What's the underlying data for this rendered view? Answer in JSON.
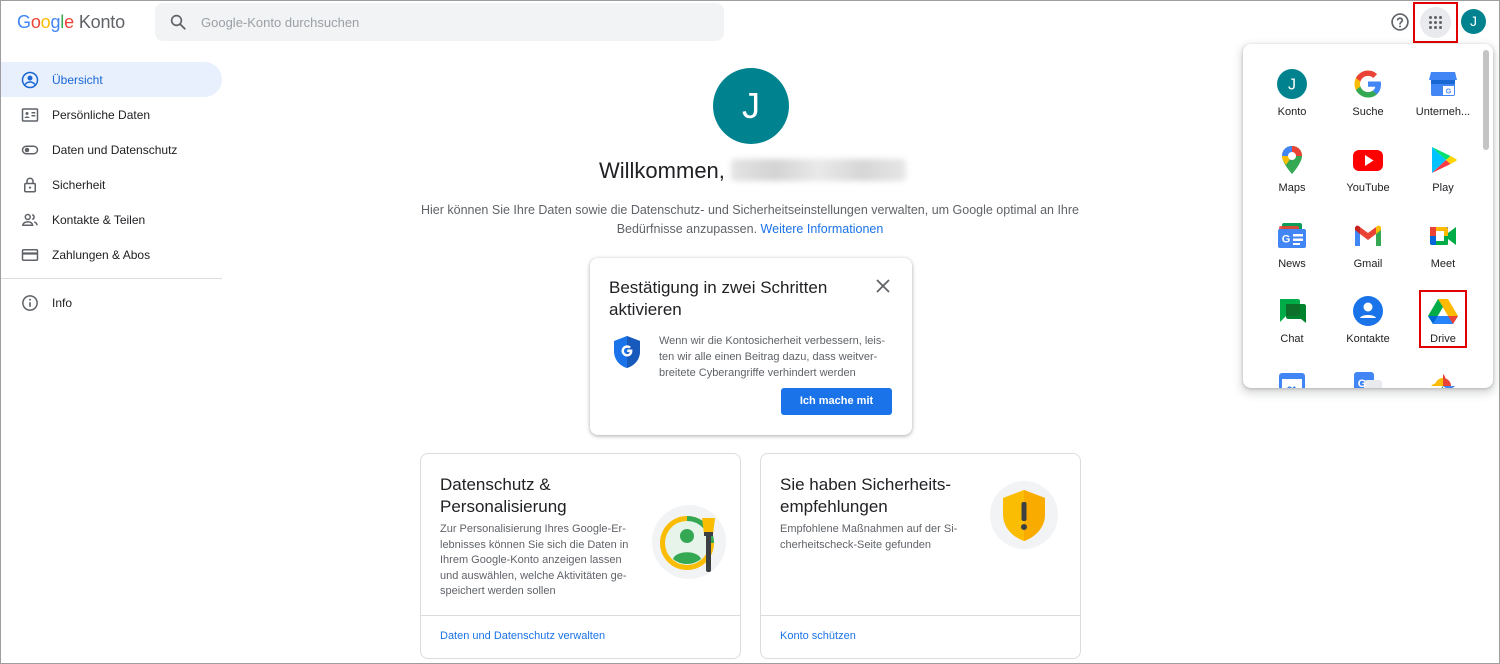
{
  "header": {
    "logo_google": "Google",
    "logo_konto": "Konto",
    "search_placeholder": "Google-Konto durchsuchen",
    "avatar_letter": "J"
  },
  "sidebar": {
    "items": [
      {
        "label": "Übersicht",
        "icon": "account-circle-icon",
        "active": true
      },
      {
        "label": "Persönliche Daten",
        "icon": "id-card-icon"
      },
      {
        "label": "Daten und Datenschutz",
        "icon": "toggle-icon"
      },
      {
        "label": "Sicherheit",
        "icon": "lock-icon"
      },
      {
        "label": "Kontakte & Teilen",
        "icon": "people-icon"
      },
      {
        "label": "Zahlungen & Abos",
        "icon": "credit-card-icon"
      }
    ],
    "info_label": "Info"
  },
  "main": {
    "avatar_letter": "J",
    "welcome": "Willkommen,",
    "intro": "Hier können Sie Ihre Daten sowie die Datenschutz- und Sicherheitseinstellungen verwalten, um Google optimal an Ihre Bedürfnisse anzupassen.",
    "intro_link": "Weitere Informationen",
    "twofa_card": {
      "title": "Bestätigung in zwei Schritten aktivieren",
      "text": "Wenn wir die Kontosicherheit verbessern, leis-ten wir alle einen Beitrag dazu, dass weitver-breitete Cyberangriffe verhindert werden",
      "button": "Ich mache mit"
    },
    "privacy_card": {
      "title": "Datenschutz & Personalisierung",
      "desc": "Zur Personalisierung Ihres Google-Er-lebnisses können Sie sich die Daten in Ihrem Google-Konto anzeigen lassen und auswählen, welche Aktivitäten ge-speichert werden sollen",
      "link": "Daten und Datenschutz verwalten"
    },
    "security_card": {
      "title": "Sie haben Sicherheits-empfehlungen",
      "desc": "Empfohlene Maßnahmen auf der Si-cherheitscheck-Seite gefunden",
      "link": "Konto schützen"
    }
  },
  "apps_panel": {
    "apps": [
      {
        "label": "Konto"
      },
      {
        "label": "Suche"
      },
      {
        "label": "Unterneh..."
      },
      {
        "label": "Maps"
      },
      {
        "label": "YouTube"
      },
      {
        "label": "Play"
      },
      {
        "label": "News"
      },
      {
        "label": "Gmail"
      },
      {
        "label": "Meet"
      },
      {
        "label": "Chat"
      },
      {
        "label": "Kontakte"
      },
      {
        "label": "Drive"
      }
    ]
  },
  "colors": {
    "accent_blue": "#1a73e8",
    "avatar_teal": "#00838f",
    "highlight_red": "#e00000"
  }
}
